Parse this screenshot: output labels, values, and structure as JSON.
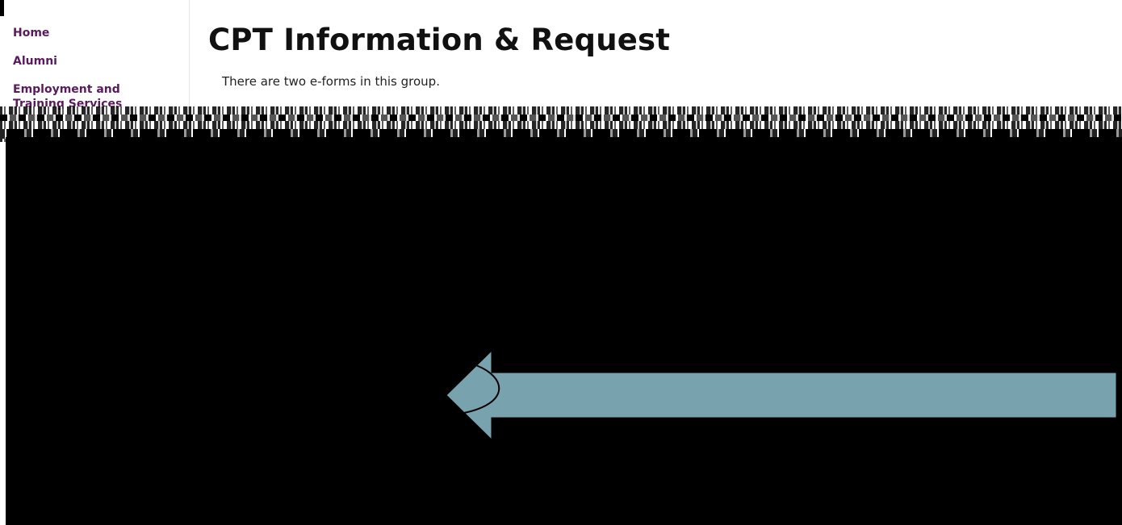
{
  "sidebar": {
    "items": [
      {
        "label": "Home"
      },
      {
        "label": "Alumni"
      },
      {
        "label": "Employment and Training Services"
      }
    ],
    "link_color": "#5a1a5e"
  },
  "main": {
    "title": "CPT Information & Request",
    "intro": "There are two e-forms in this group."
  },
  "overlay": {
    "color": "#000000",
    "arrow_color": "#78a3ae",
    "arrow_direction": "left"
  }
}
